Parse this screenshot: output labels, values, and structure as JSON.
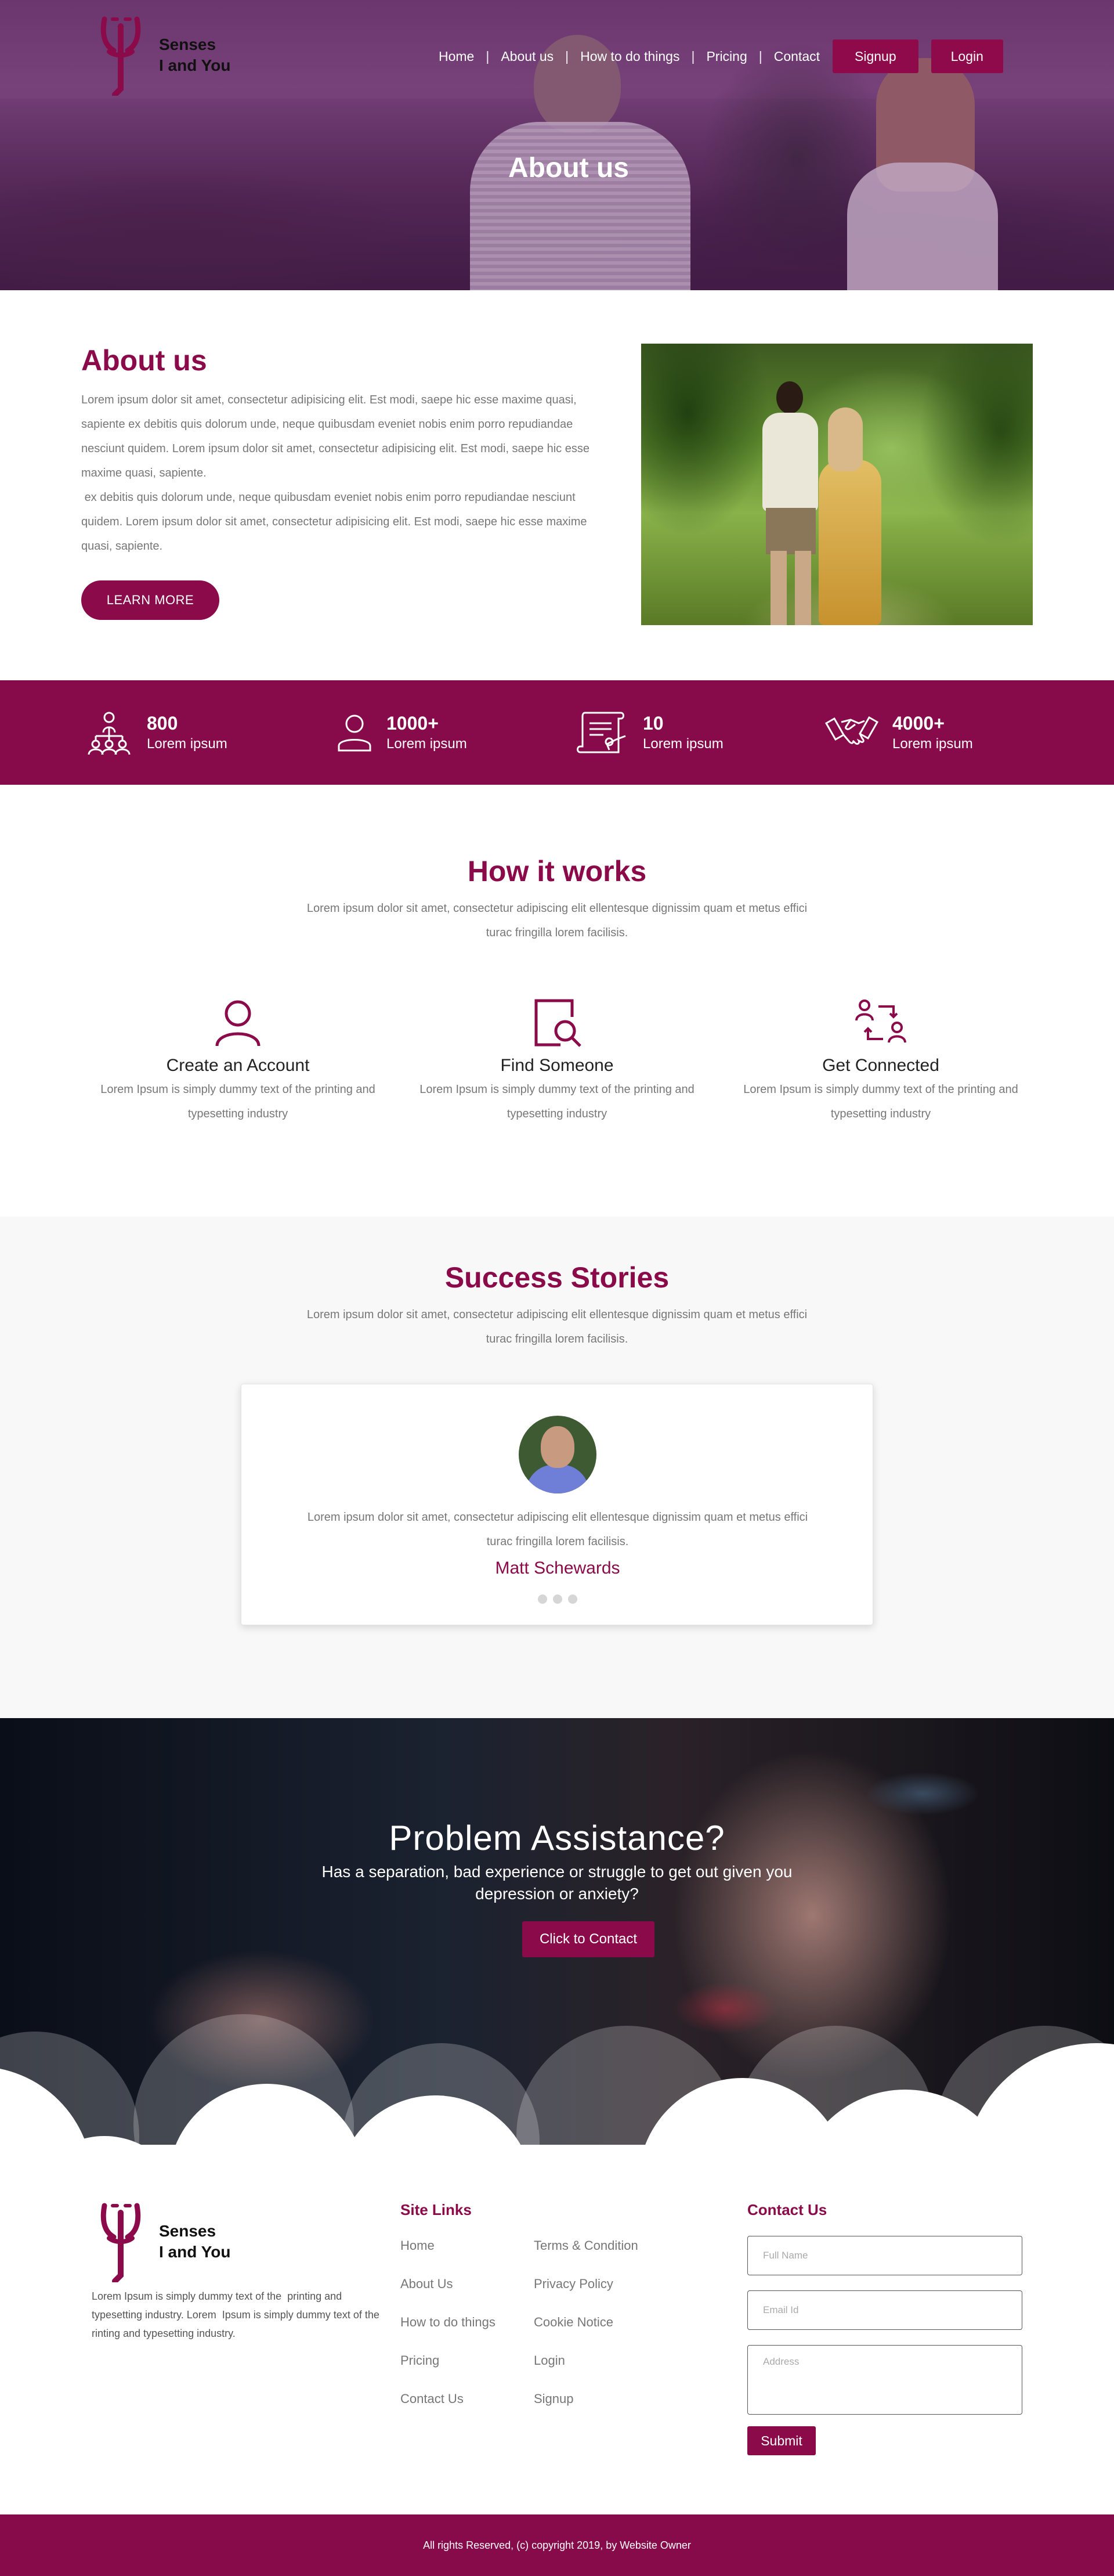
{
  "brand": {
    "line1": "Senses",
    "line2": "I and You"
  },
  "nav": {
    "links": [
      "Home",
      "About us",
      "How to do things",
      "Pricing",
      "Contact"
    ],
    "separator": "|",
    "signup": "Signup",
    "login": "Login"
  },
  "hero": {
    "title": "About us"
  },
  "about": {
    "title": "About us",
    "paragraph1": "Lorem ipsum dolor sit amet, consectetur adipisicing elit. Est modi, saepe hic esse maxime quasi, sapiente ex debitis quis dolorum unde, neque quibusdam eveniet nobis enim porro repudiandae nesciunt quidem. Lorem ipsum dolor sit amet, consectetur adipisicing elit. Est modi, saepe hic esse maxime quasi, sapiente.",
    "paragraph2": " ex debitis quis dolorum unde, neque quibusdam eveniet nobis enim porro repudiandae nesciunt quidem. Lorem ipsum dolor sit amet, consectetur adipisicing elit. Est modi, saepe hic esse maxime quasi, sapiente.",
    "button": "LEARN MORE"
  },
  "stats": [
    {
      "icon": "group-icon",
      "value": "800",
      "label": "Lorem ipsum"
    },
    {
      "icon": "user-icon",
      "value": "1000+",
      "label": "Lorem ipsum"
    },
    {
      "icon": "certificate-icon",
      "value": "10",
      "label": "Lorem ipsum"
    },
    {
      "icon": "handshake-icon",
      "value": "4000+",
      "label": "Lorem ipsum"
    }
  ],
  "how": {
    "title": "How it works",
    "subtitle": "Lorem ipsum dolor sit amet, consectetur adipiscing elit ellentesque dignissim quam et metus effici turac fringilla lorem facilisis.",
    "steps": [
      {
        "icon": "account-icon",
        "title": "Create an Account",
        "text": "Lorem Ipsum is simply dummy text of the printing and typesetting industry"
      },
      {
        "icon": "search-icon",
        "title": "Find Someone",
        "text": "Lorem Ipsum is simply dummy text of the printing and typesetting industry"
      },
      {
        "icon": "connect-icon",
        "title": "Get Connected",
        "text": "Lorem Ipsum is simply dummy text of the printing and typesetting industry"
      }
    ]
  },
  "stories": {
    "title": "Success Stories",
    "subtitle": "Lorem ipsum dolor sit amet, consectetur adipiscing elit ellentesque dignissim quam et metus effici turac fringilla lorem facilisis.",
    "quote": "Lorem ipsum dolor sit amet, consectetur adipiscing elit ellentesque dignissim quam et metus effici turac fringilla lorem facilisis.",
    "name": "Matt Schewards"
  },
  "problem": {
    "title": "Problem Assistance?",
    "subtitle": "Has a separation, bad experience or struggle to get out given you depression or anxiety?",
    "button": "Click to Contact"
  },
  "footer": {
    "about": "Lorem Ipsum is simply dummy text of the  printing and typesetting industry. Lorem  Ipsum is simply dummy text of the   rinting and typesetting industry.",
    "site_links_title": "Site Links",
    "links_col1": [
      "Home",
      "About Us",
      "How to do things",
      "Pricing",
      "Contact Us"
    ],
    "links_col2": [
      "Terms & Condition",
      "Privacy Policy",
      "Cookie Notice",
      "Login",
      "Signup"
    ],
    "contact_title": "Contact Us",
    "placeholders": {
      "name": "Full Name",
      "email": "Email Id",
      "address": "Address"
    },
    "submit": "Submit",
    "copyright": "All rights Reserved, (c) copyright 2019, by Website Owner"
  },
  "colors": {
    "brand": "#8a0a4a",
    "stats_bg": "#870b4a",
    "text_muted": "#777777"
  }
}
